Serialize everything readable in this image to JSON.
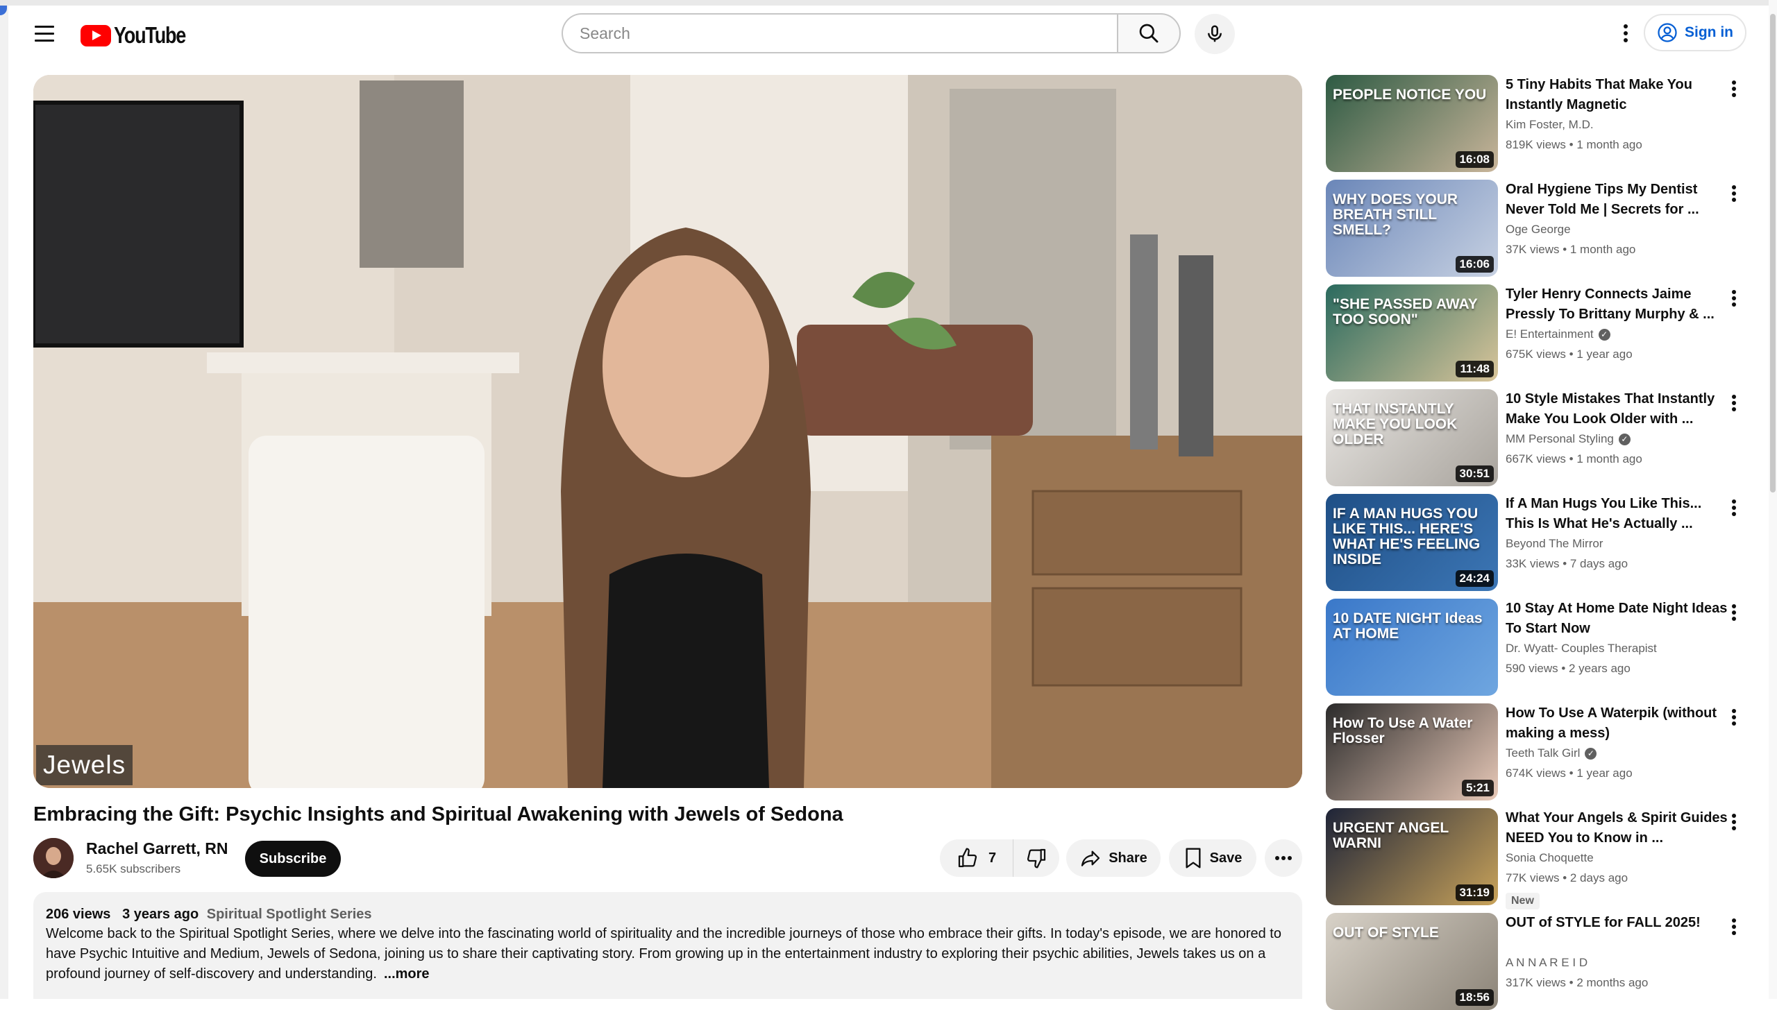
{
  "header": {
    "logo_text": "YouTube",
    "search_placeholder": "Search",
    "signin_label": "Sign in"
  },
  "player": {
    "overlay_label": "Jewels"
  },
  "video": {
    "title": "Embracing the Gift: Psychic Insights and Spiritual Awakening with Jewels of Sedona",
    "channel": "Rachel Garrett, RN",
    "subscribers": "5.65K subscribers",
    "subscribe_label": "Subscribe",
    "likes": "7",
    "share_label": "Share",
    "save_label": "Save"
  },
  "description": {
    "views": "206 views",
    "age": "3 years ago",
    "series": "Spiritual Spotlight Series",
    "text": "Welcome back to the Spiritual Spotlight Series, where we delve into the fascinating world of spirituality and the incredible journeys of those who embrace their gifts. In today's episode, we are honored to have Psychic Intuitive and Medium, Jewels of Sedona, joining us to share their captivating story. From growing up in the entertainment industry to exploring their psychic abilities, Jewels takes us on a profound journey of self-discovery and understanding.",
    "more_label": "...more"
  },
  "recommendations": [
    {
      "title": "5 Tiny Habits That Make You Instantly Magnetic",
      "channel": "Kim Foster, M.D.",
      "verified": false,
      "meta": "819K views • 1 month ago",
      "duration": "16:08",
      "thumb_text": "PEOPLE NOTICE YOU",
      "thumb_colors": [
        "#2d5a43",
        "#c9b59a"
      ]
    },
    {
      "title": "Oral Hygiene Tips My Dentist Never Told Me | Secrets for ...",
      "channel": "Oge George",
      "verified": false,
      "meta": "37K views • 1 month ago",
      "duration": "16:06",
      "thumb_text": "WHY DOES YOUR BREATH STILL SMELL?",
      "thumb_colors": [
        "#6a86b8",
        "#c7d1e2"
      ]
    },
    {
      "title": "Tyler Henry Connects Jaime Pressly To Brittany Murphy & ...",
      "channel": "E! Entertainment",
      "verified": true,
      "meta": "675K views • 1 year ago",
      "duration": "11:48",
      "thumb_text": "\"SHE PASSED AWAY TOO SOON\"",
      "thumb_colors": [
        "#2a6a5e",
        "#d9c59a"
      ]
    },
    {
      "title": "10 Style Mistakes That Instantly Make You Look Older with ...",
      "channel": "MM Personal Styling",
      "verified": true,
      "meta": "667K views • 1 month ago",
      "duration": "30:51",
      "thumb_text": "THAT INSTANTLY MAKE YOU LOOK OLDER",
      "thumb_colors": [
        "#e8e6e3",
        "#a8a39c"
      ]
    },
    {
      "title": "If A Man Hugs You Like This... This Is What He's Actually ...",
      "channel": "Beyond The Mirror",
      "verified": false,
      "meta": "33K views • 7 days ago",
      "duration": "24:24",
      "thumb_text": "IF A MAN HUGS YOU LIKE THIS... HERE'S WHAT HE'S FEELING INSIDE",
      "thumb_colors": [
        "#1f4f86",
        "#3c76b5"
      ]
    },
    {
      "title": "10 Stay At Home Date Night Ideas To Start Now",
      "channel": "Dr. Wyatt- Couples Therapist",
      "verified": false,
      "meta": "590 views • 2 years ago",
      "duration": "",
      "thumb_text": "10 DATE NIGHT Ideas AT HOME",
      "thumb_colors": [
        "#3a78c9",
        "#6fa6e0"
      ]
    },
    {
      "title": "How To Use A Waterpik (without making a mess)",
      "channel": "Teeth Talk Girl",
      "verified": true,
      "meta": "674K views • 1 year ago",
      "duration": "5:21",
      "thumb_text": "How To Use A Water Flosser",
      "thumb_colors": [
        "#2b2b2b",
        "#e8c9b8"
      ]
    },
    {
      "title": "What Your Angels & Spirit Guides NEED You to Know in ...",
      "channel": "Sonia Choquette",
      "verified": false,
      "meta": "77K views • 2 days ago",
      "duration": "31:19",
      "thumb_text": "URGENT ANGEL WARNI",
      "thumb_colors": [
        "#1e2438",
        "#c9a35a"
      ],
      "badge": "New"
    },
    {
      "title": "OUT of STYLE for FALL 2025!",
      "channel": "A N N A R E I D",
      "verified": false,
      "meta": "317K views • 2 months ago",
      "duration": "18:56",
      "thumb_text": "OUT OF STYLE",
      "thumb_colors": [
        "#d8d2c8",
        "#8c8478"
      ]
    }
  ]
}
